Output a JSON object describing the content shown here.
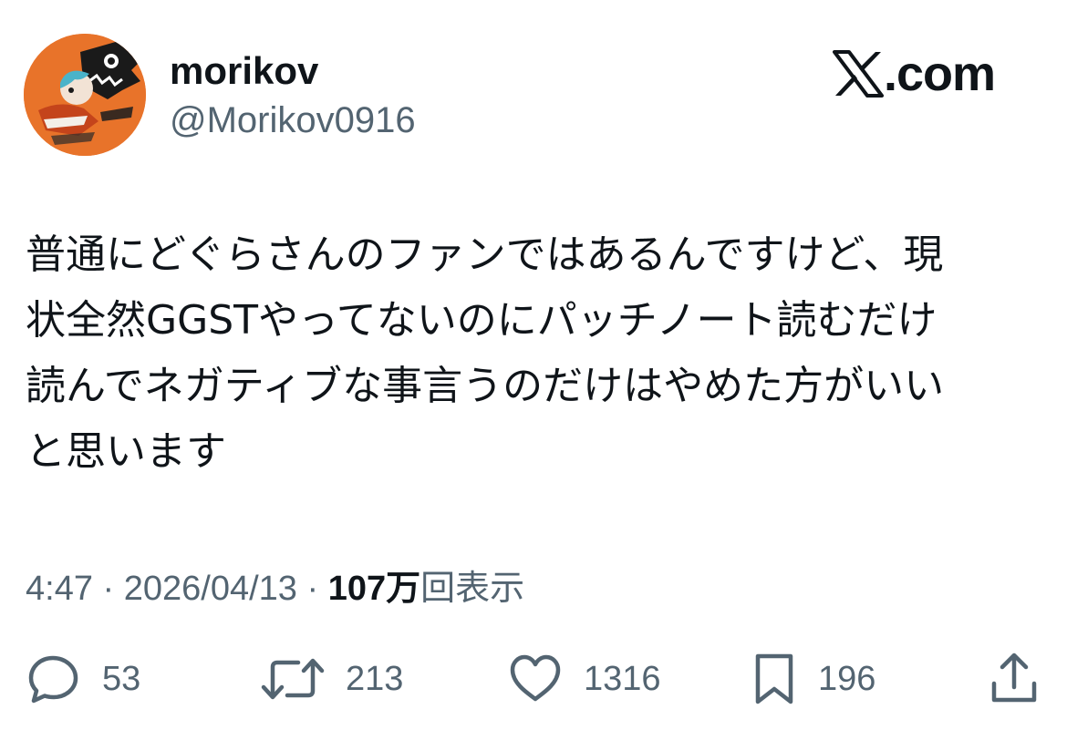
{
  "author": {
    "display_name": "morikov",
    "handle": "@Morikov0916"
  },
  "site": {
    "icon": "x-logo-icon",
    "domain_suffix": ".com"
  },
  "tweet": {
    "lines": [
      "普通にどぐらさんのファンではあるんですけど、現",
      "状全然GGSTやってないのにパッチノート読むだけ",
      "読んでネガティブな事言うのだけはやめた方がいい",
      "と思います"
    ]
  },
  "meta": {
    "time": "4:47",
    "separator": " · ",
    "date": "2026/04/13",
    "views_count": "107",
    "views_unit": "万",
    "views_label": "回表示"
  },
  "actions": {
    "reply": {
      "icon": "reply-icon",
      "count": "53"
    },
    "repost": {
      "icon": "repost-icon",
      "count": "213"
    },
    "like": {
      "icon": "heart-icon",
      "count": "1316"
    },
    "bookmark": {
      "icon": "bookmark-icon",
      "count": "196"
    },
    "share": {
      "icon": "share-icon"
    }
  },
  "colors": {
    "text_primary": "#0f1419",
    "text_secondary": "#536471",
    "avatar_bg": "#e8732a"
  }
}
